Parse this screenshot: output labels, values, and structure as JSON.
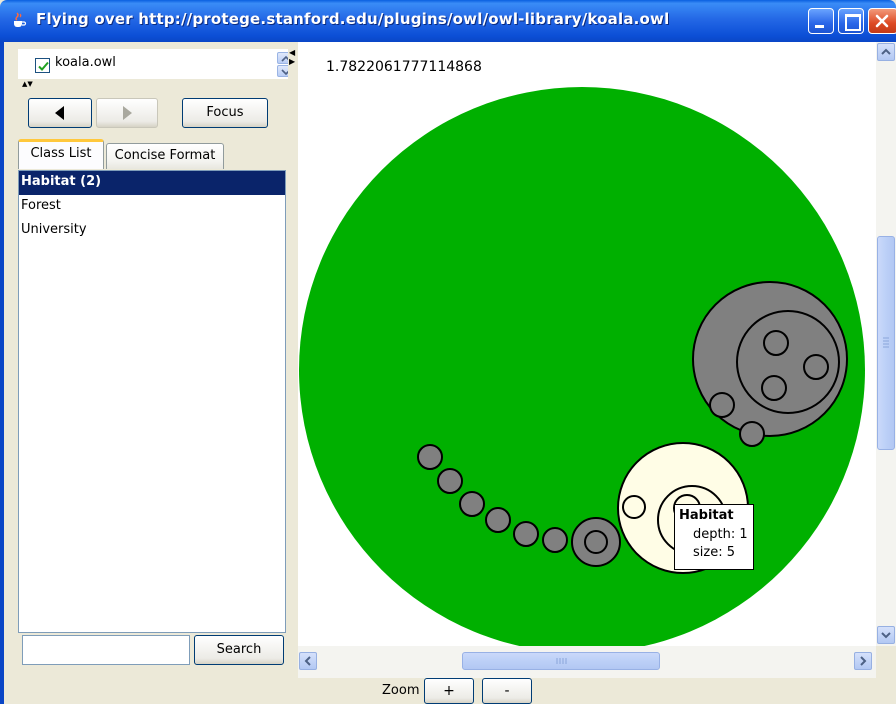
{
  "window": {
    "title": "Flying over http://protege.stanford.edu/plugins/owl/owl-library/koala.owl",
    "icon": "java-cup-icon"
  },
  "ontology_selector": {
    "label": "koala.owl",
    "checked": true
  },
  "nav": {
    "focus_label": "Focus"
  },
  "tabs": [
    {
      "label": "Class List",
      "active": true
    },
    {
      "label": "Concise Format",
      "active": false
    }
  ],
  "class_list": {
    "items": [
      {
        "label": "Habitat (2)",
        "selected": true
      },
      {
        "label": "Forest",
        "selected": false
      },
      {
        "label": "University",
        "selected": false
      }
    ]
  },
  "search": {
    "value": "",
    "button_label": "Search"
  },
  "canvas": {
    "zoom_value": "1.7822061777114868",
    "colors": {
      "root": "#00b000",
      "node": "#808080",
      "highlight": "#fffde6",
      "stroke": "#000000"
    }
  },
  "tooltip": {
    "title": "Habitat",
    "depth_label": "depth: 1",
    "size_label": "size: 5"
  },
  "zoom_bar": {
    "label": "Zoom",
    "plus_label": "+",
    "minus_label": "-"
  }
}
